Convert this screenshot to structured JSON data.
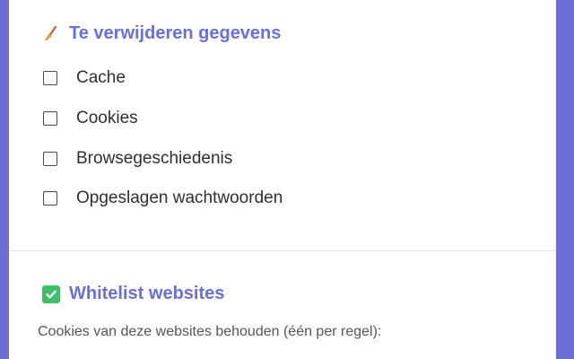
{
  "sections": {
    "remove": {
      "icon": "broom-icon",
      "title": "Te verwijderen gegevens",
      "options": [
        {
          "label": "Cache",
          "checked": false
        },
        {
          "label": "Cookies",
          "checked": false
        },
        {
          "label": "Browsegeschiedenis",
          "checked": false
        },
        {
          "label": "Opgeslagen wachtwoorden",
          "checked": false
        }
      ]
    },
    "whitelist": {
      "icon": "check-mark-button-icon",
      "title": "Whitelist websites",
      "description": "Cookies van deze websites behouden (één per regel):"
    }
  },
  "colors": {
    "background": "#6b6fd6",
    "title": "#6a6fdc",
    "check_green": "#3fbf6a"
  }
}
